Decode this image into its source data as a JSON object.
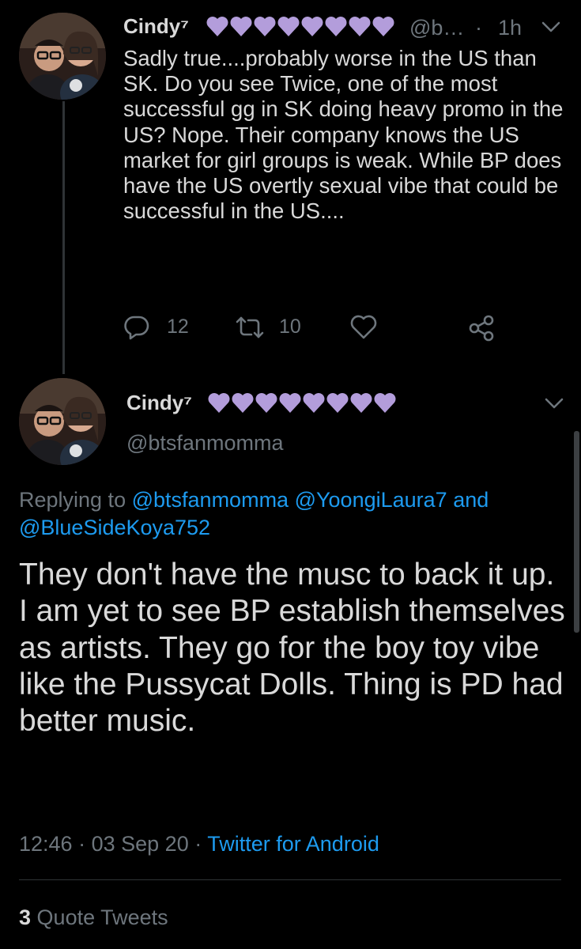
{
  "colors": {
    "background": "#000000",
    "text": "#d9d9d9",
    "muted": "#6e767d",
    "link": "#1d9bf0",
    "heart": "#b39ddb"
  },
  "tweet1": {
    "display_name": "Cindy⁷",
    "heart_emoji_count": 8,
    "handle": "@b…",
    "separator": "·",
    "time": "1h",
    "text": "Sadly true....probably worse in the US than SK. Do you see Twice, one of the most successful gg in SK doing heavy promo in the US? Nope. Their company knows the US market for girl groups is weak. While BP does have the US overtly sexual vibe that could be successful in the US....",
    "reply_count": "12",
    "retweet_count": "10",
    "icons": [
      "reply-icon",
      "retweet-icon",
      "like-icon",
      "share-icon",
      "chevron-down-icon"
    ]
  },
  "tweet2": {
    "display_name": "Cindy⁷",
    "heart_emoji_count": 8,
    "handle": "@btsfanmomma",
    "replying_prefix": "Replying to",
    "replying_to": [
      "@btsfanmomma",
      "@YoongiLaura7",
      "@BlueSideKoya752"
    ],
    "replying_and": "and",
    "text": "They don't have the musc to back it up. I am yet to see BP establish themselves as artists. They go for the boy toy vibe like the Pussycat Dolls. Thing is PD had better music.",
    "time": "12:46",
    "separator": "·",
    "date": "03 Sep 20",
    "source": "Twitter for Android",
    "quote_count": "3",
    "quote_label": "Quote Tweets"
  }
}
